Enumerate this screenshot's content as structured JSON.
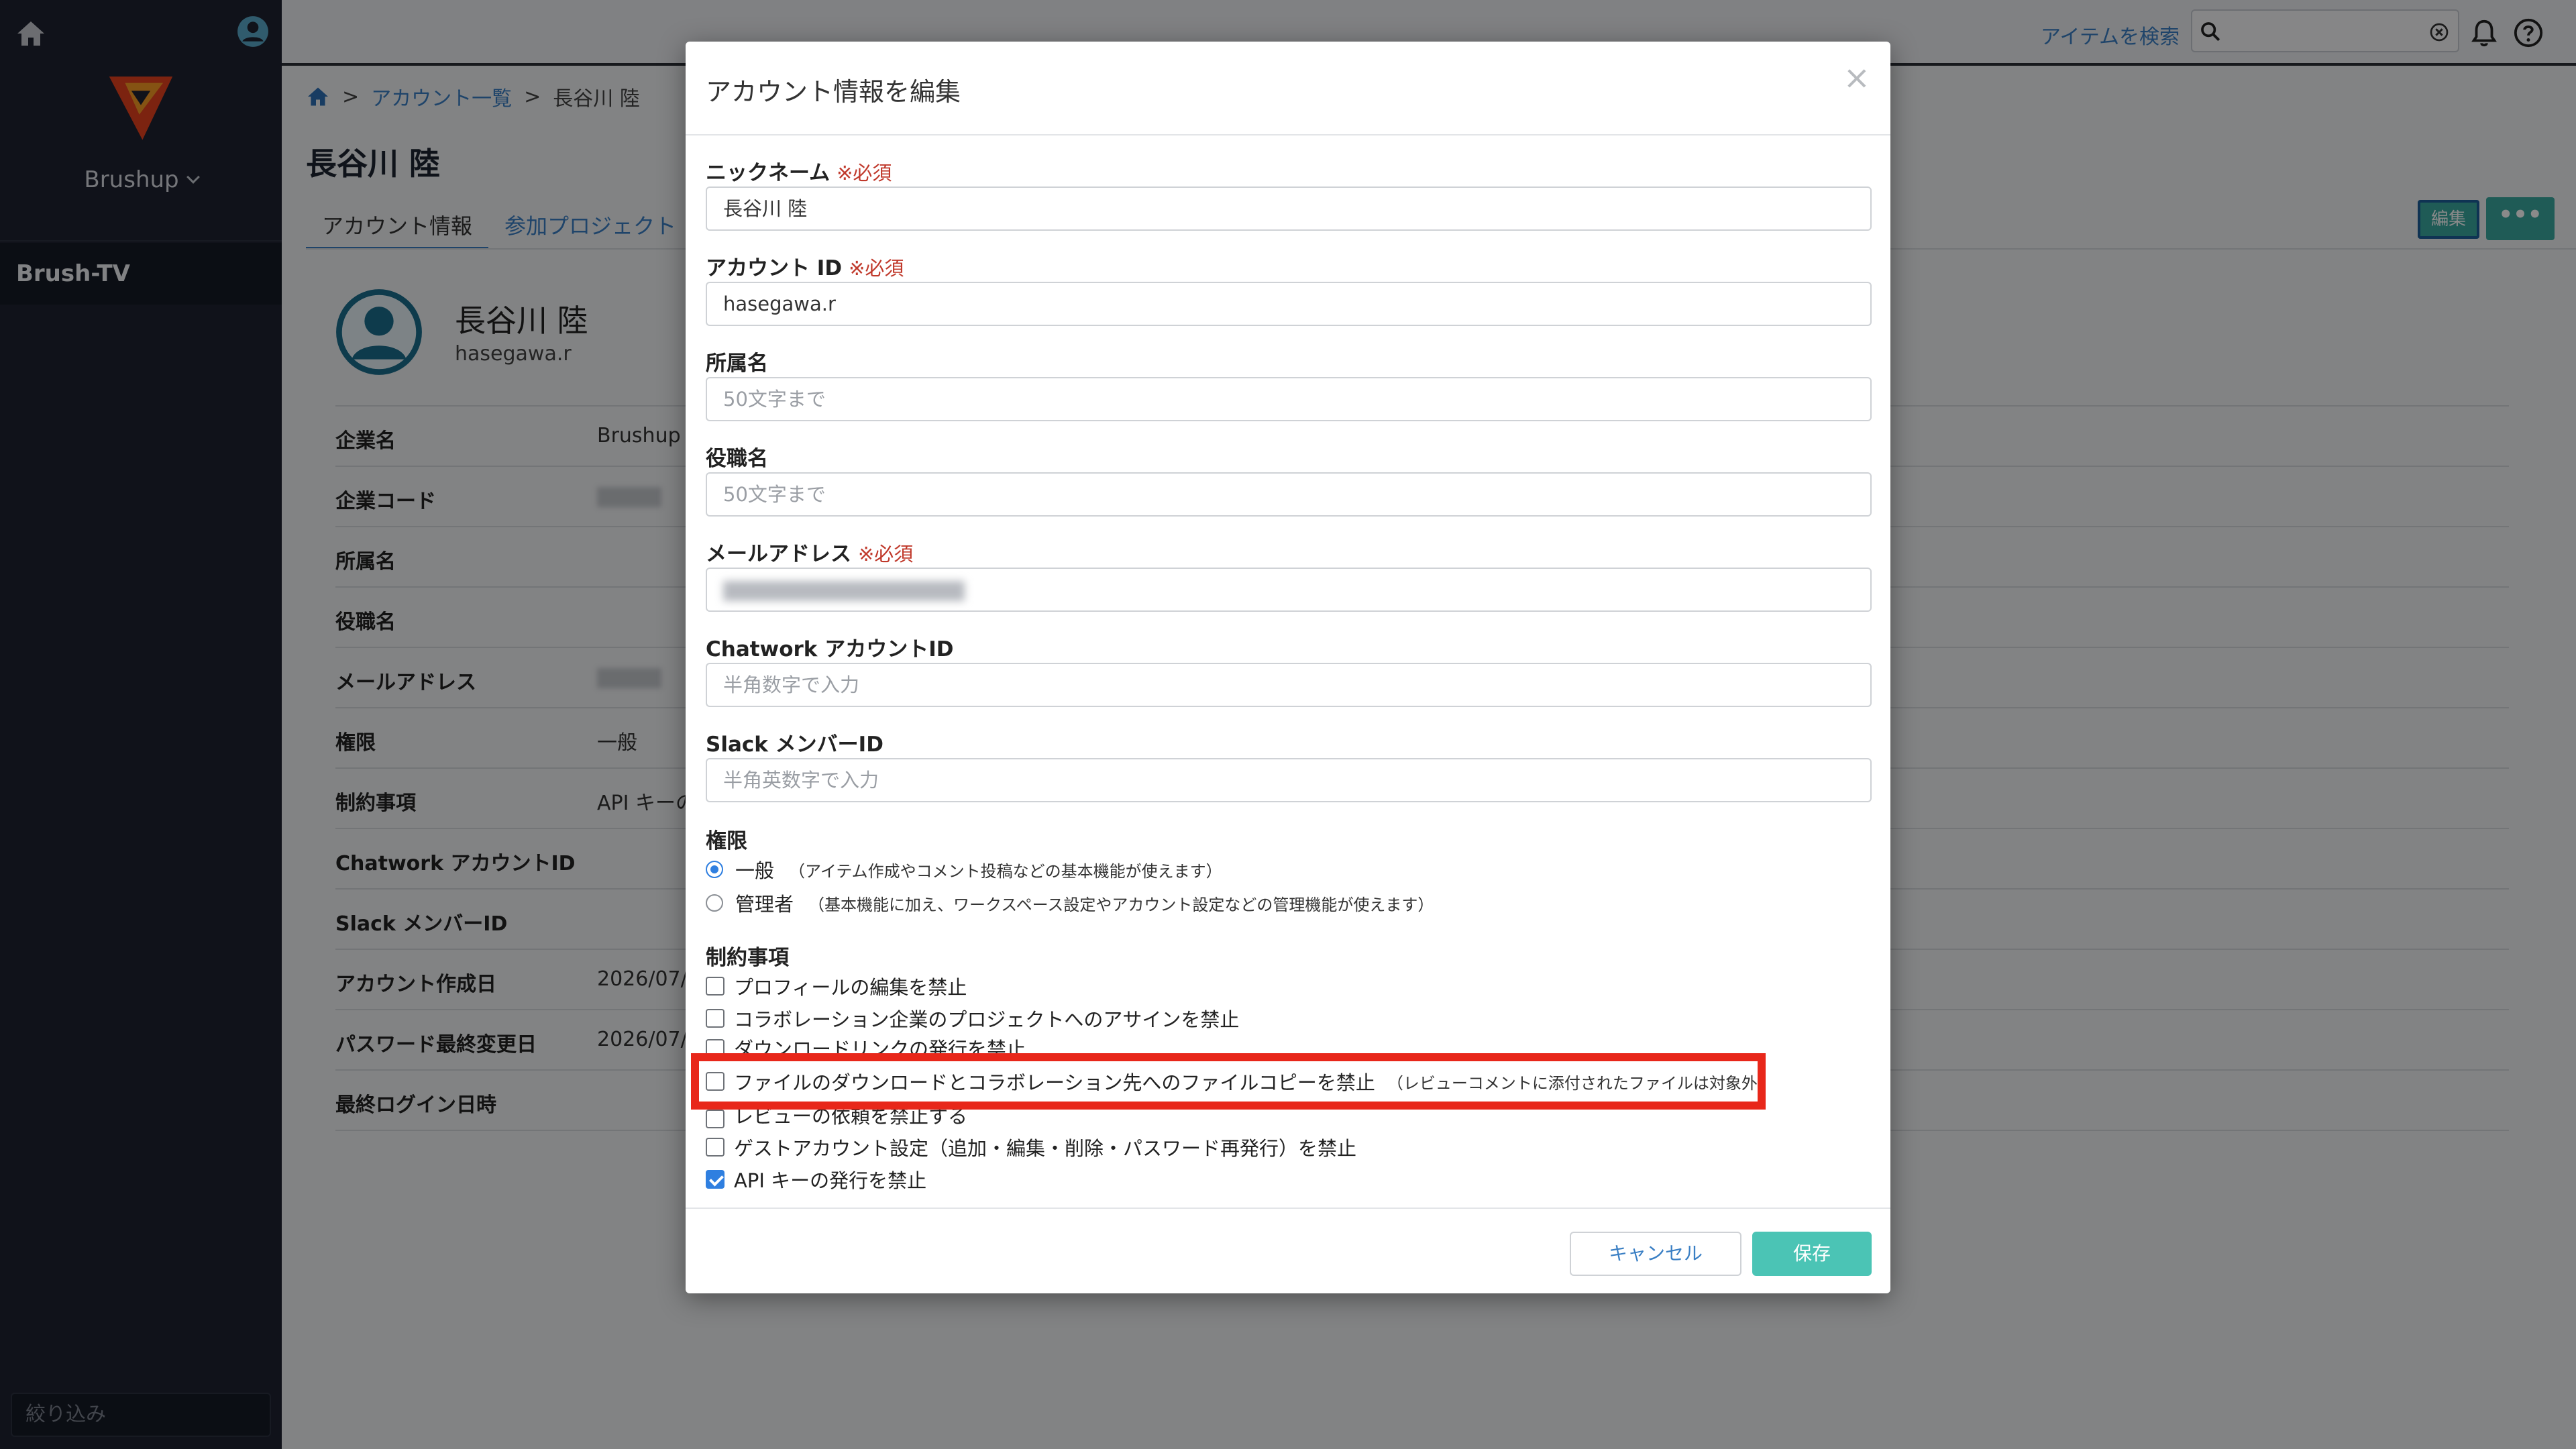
{
  "sidebar": {
    "workspace_name": "Brushup",
    "active_item": "Brush-TV",
    "filter_placeholder": "絞り込み"
  },
  "topbar": {
    "search_link": "アイテムを検索"
  },
  "breadcrumb": {
    "accounts_link": "アカウント一覧",
    "current": "長谷川 陸",
    "separator": ">"
  },
  "page": {
    "title": "長谷川 陸",
    "tabs": [
      {
        "label": "アカウント情報"
      },
      {
        "label": "参加プロジェクト"
      }
    ],
    "edit_button": "編集",
    "more_button": "•••"
  },
  "profile": {
    "name": "長谷川 陸",
    "account_id": "hasegawa.r",
    "rows": [
      {
        "label": "企業名",
        "value": "Brushup"
      },
      {
        "label": "企業コード",
        "value": ""
      },
      {
        "label": "所属名",
        "value": ""
      },
      {
        "label": "役職名",
        "value": ""
      },
      {
        "label": "メールアドレス",
        "value": ""
      },
      {
        "label": "権限",
        "value": "一般"
      },
      {
        "label": "制約事項",
        "value": "API キーの"
      },
      {
        "label": "Chatwork アカウントID",
        "value": ""
      },
      {
        "label": "Slack メンバーID",
        "value": ""
      },
      {
        "label": "アカウント作成日",
        "value": "2026/07/"
      },
      {
        "label": "パスワード最終変更日",
        "value": "2026/07/"
      },
      {
        "label": "最終ログイン日時",
        "value": ""
      }
    ]
  },
  "modal": {
    "title": "アカウント情報を編集",
    "close": "×",
    "required_mark": "※必須",
    "fields": {
      "nickname": {
        "label": "ニックネーム",
        "value": "長谷川 陸"
      },
      "account_id": {
        "label": "アカウント ID",
        "value": "hasegawa.r"
      },
      "department": {
        "label": "所属名",
        "placeholder": "50文字まで"
      },
      "position": {
        "label": "役職名",
        "placeholder": "50文字まで"
      },
      "email": {
        "label": "メールアドレス"
      },
      "chatwork": {
        "label": "Chatwork アカウントID",
        "placeholder": "半角数字で入力"
      },
      "slack": {
        "label": "Slack メンバーID",
        "placeholder": "半角英数字で入力"
      }
    },
    "permission": {
      "label": "権限",
      "options": [
        {
          "label": "一般",
          "desc": "（アイテム作成やコメント投稿などの基本機能が使えます）",
          "selected": true
        },
        {
          "label": "管理者",
          "desc": "（基本機能に加え、ワークスペース設定やアカウント設定などの管理機能が使えます）",
          "selected": false
        }
      ]
    },
    "restrictions": {
      "label": "制約事項",
      "items": [
        {
          "label": "プロフィールの編集を禁止",
          "desc": "",
          "checked": false
        },
        {
          "label": "コラボレーション企業のプロジェクトへのアサインを禁止",
          "desc": "",
          "checked": false
        },
        {
          "label": "ダウンロードリンクの発行を禁止",
          "desc": "",
          "checked": false
        },
        {
          "label": "ファイルのダウンロードとコラボレーション先へのファイルコピーを禁止",
          "desc": "（レビューコメントに添付されたファイルは対象外）",
          "checked": false
        },
        {
          "label": "レビューの依頼を禁止する",
          "desc": "",
          "checked": false
        },
        {
          "label": "ゲストアカウント設定（追加・編集・削除・パスワード再発行）を禁止",
          "desc": "",
          "checked": false
        },
        {
          "label": "API キーの発行を禁止",
          "desc": "",
          "checked": true
        }
      ]
    },
    "cancel_button": "キャンセル",
    "save_button": "保存"
  },
  "colors": {
    "accent": "#3a7fc4",
    "primary_button": "#4bc4b5",
    "highlight": "#e8271a",
    "required": "#c0392b"
  }
}
